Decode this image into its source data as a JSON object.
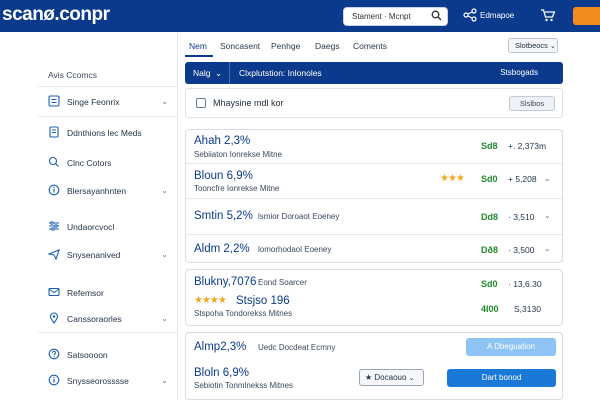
{
  "header": {
    "logo": "scanø.conpr",
    "search_label": "Stament · Mcnpt",
    "link": "Edmapoe"
  },
  "sidebar": {
    "title": "Avis Ccomcs",
    "items": [
      {
        "label": "Singe Feonrix",
        "icon": "list-icon",
        "chevron": true
      },
      {
        "label": "Ddnthions lec Meds",
        "icon": "book-icon",
        "chevron": false
      },
      {
        "label": "Clnc Cotors",
        "icon": "search-icon",
        "chevron": false
      },
      {
        "label": "Blersayanhnten",
        "icon": "info-icon",
        "chevron": true
      },
      {
        "label": "Undaorcvocl",
        "icon": "sliders-icon",
        "chevron": false
      },
      {
        "label": "Snysenanived",
        "icon": "plane-icon",
        "chevron": true
      },
      {
        "label": "Refemsor",
        "icon": "mail-icon",
        "chevron": false
      },
      {
        "label": "Canssoraorles",
        "icon": "pin-icon",
        "chevron": true
      },
      {
        "label": "Satsoooon",
        "icon": "help-icon",
        "chevron": false
      },
      {
        "label": "Snysseorosssse",
        "icon": "info-icon",
        "chevron": true
      }
    ]
  },
  "tabs": [
    "Nem",
    "Soncasent",
    "Penhge",
    "Daegs",
    "Coments"
  ],
  "sort_label": "Slotbeocs",
  "filterbar": {
    "left": "Nalg",
    "middle": "Clxplutstion: Inlonoles",
    "right": "Stsbogads"
  },
  "checkrow": {
    "label": "Mhaysine mdl kor",
    "button": "Slslbos"
  },
  "results": [
    {
      "title": "Ahah 2,3%",
      "subtitle": "Sebiiaton Ionrekse Mitne",
      "price": "Sd8",
      "value": "+. 2,373m",
      "stars": 0,
      "chevron": false,
      "group": 1
    },
    {
      "title": "Bloun 6,9%",
      "subtitle": "Tooncfre Ionrekse Mitne",
      "price": "Sd0",
      "value": "+ 5,208",
      "stars": 3,
      "chevron": true,
      "group": 1
    },
    {
      "title": "Smtin 5,2%",
      "subtitle": "lsmior Doroaot Eoeney",
      "price": "Dd8",
      "value": "· 3,510",
      "stars": 0,
      "chevron": true,
      "group": 1
    },
    {
      "title": "Aldm 2,2%",
      "subtitle": "lomorhodaol Eoeney",
      "price": "Dð8",
      "value": "· 3,500",
      "stars": 0,
      "chevron": true,
      "group": 1
    },
    {
      "title": "Blukny,7076",
      "subtitle": "Eond Soarcer",
      "price": "Sd0",
      "value": "· 13,6.30",
      "stars": 0,
      "chevron": false,
      "group": 2
    },
    {
      "title": "Stsjso 196",
      "subtitle": "Stspoha Tondorekss Mitnes",
      "price": "4l00",
      "value": "S,3130",
      "stars": 4,
      "chevron": false,
      "group": 2
    },
    {
      "title": "Almp2,3%",
      "subtitle": "Uedc Docdeat Ecmny",
      "price": "",
      "value": "",
      "stars": 0,
      "chevron": false,
      "group": 3
    },
    {
      "title": "Bloln 6,9%",
      "subtitle": "Sebiotin Tonmlnekss Mitnes",
      "price": "",
      "value": "",
      "stars": 0,
      "chevron": false,
      "group": 3
    }
  ],
  "buttons": {
    "light": "A Dbeguation",
    "select": "★ Docaouo",
    "primary": "Dart bonod"
  },
  "colors": {
    "brand": "#0b3a8c",
    "accent": "#f08c1e",
    "price_green": "#1e8a2a",
    "star": "#f0a81e",
    "primary_button": "#1a78d6"
  }
}
